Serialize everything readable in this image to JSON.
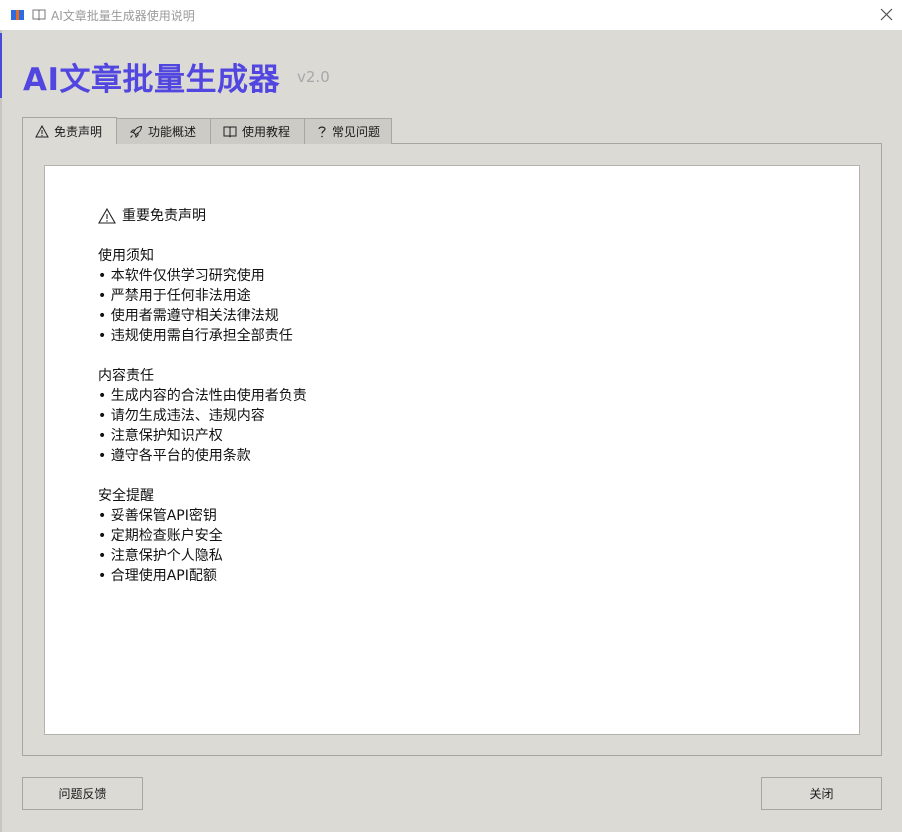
{
  "window": {
    "title": "AI文章批量生成器使用说明",
    "close_icon": "close-icon"
  },
  "header": {
    "title": "AI文章批量生成器",
    "version": "v2.0"
  },
  "tabs": [
    {
      "label": "免责声明",
      "icon": "warning-icon"
    },
    {
      "label": "功能概述",
      "icon": "rocket-icon"
    },
    {
      "label": "使用教程",
      "icon": "book-icon"
    },
    {
      "label": "常见问题",
      "icon": "question-icon"
    }
  ],
  "content": {
    "title": "重要免责声明",
    "sections": [
      {
        "heading": "使用须知",
        "items": [
          "• 本软件仅供学习研究使用",
          "• 严禁用于任何非法用途",
          "• 使用者需遵守相关法律法规",
          "• 违规使用需自行承担全部责任"
        ]
      },
      {
        "heading": "内容责任",
        "items": [
          "• 生成内容的合法性由使用者负责",
          "• 请勿生成违法、违规内容",
          "• 注意保护知识产权",
          "• 遵守各平台的使用条款"
        ]
      },
      {
        "heading": "安全提醒",
        "items": [
          "• 妥善保管API密钥",
          "• 定期检查账户安全",
          "• 注意保护个人隐私",
          "• 合理使用API配额"
        ]
      }
    ]
  },
  "buttons": {
    "feedback": "问题反馈",
    "close": "关闭"
  },
  "colors": {
    "accent": "#5146e0",
    "background": "#dcdad5"
  }
}
